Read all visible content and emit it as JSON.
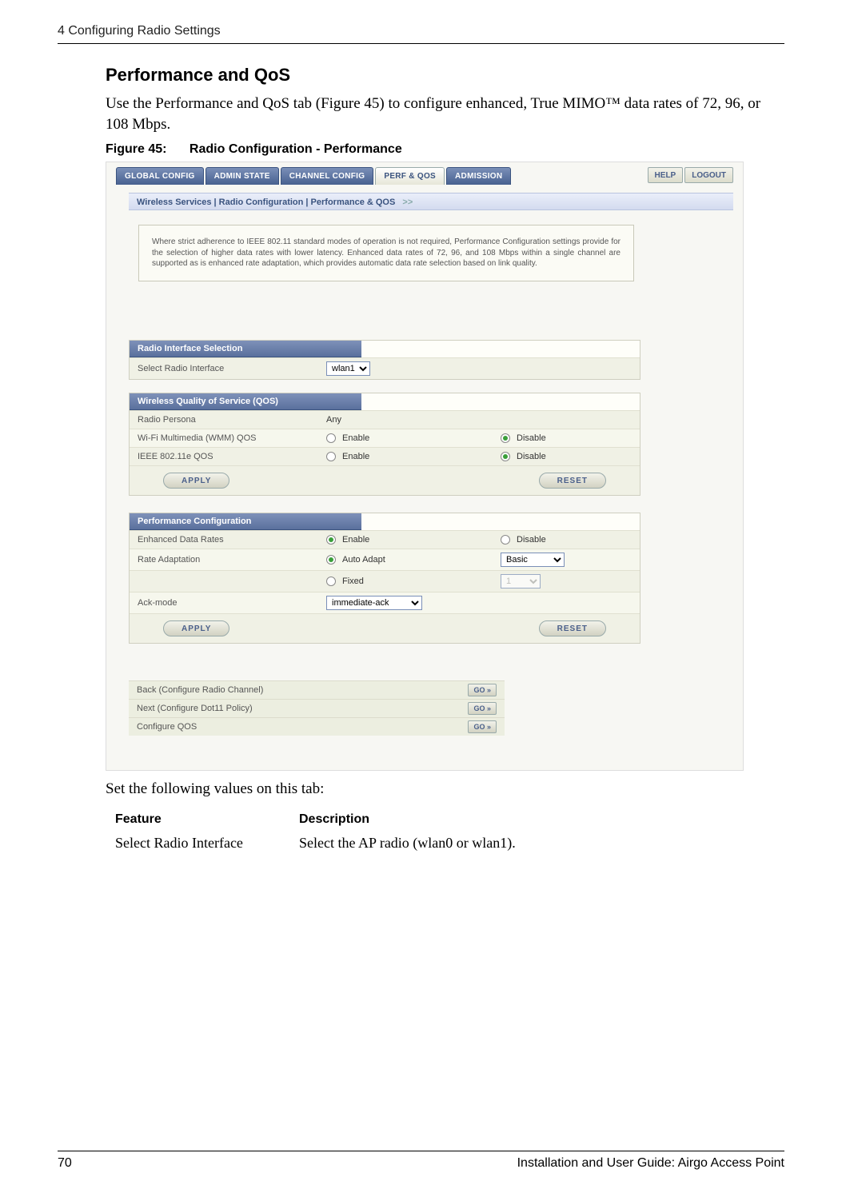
{
  "header": {
    "left": "4  Configuring Radio Settings"
  },
  "section": {
    "title": "Performance and QoS",
    "intro": "Use the Performance and QoS tab (Figure 45) to configure enhanced, True MIMO™ data rates of 72, 96, or 108 Mbps.",
    "figure_label_num": "Figure 45:",
    "figure_label_txt": "Radio Configuration - Performance",
    "after_fig": "Set the following values on this tab:"
  },
  "screenshot": {
    "tabs": [
      "GLOBAL CONFIG",
      "ADMIN STATE",
      "CHANNEL CONFIG",
      "PERF & QOS",
      "ADMISSION"
    ],
    "active_tab_index": 3,
    "help": "HELP",
    "logout": "LOGOUT",
    "breadcrumb": "Wireless Services | Radio Configuration | Performance & QOS",
    "breadcrumb_chev": ">>",
    "desc": "Where strict adherence to IEEE 802.11 standard modes of operation is not required, Performance Configuration settings provide for the selection of higher data rates with lower latency. Enhanced data rates of 72, 96, and 108 Mbps within a single channel are supported as is enhanced rate adaptation, which provides automatic data rate selection based on link quality.",
    "panel_radio": {
      "title": "Radio Interface Selection",
      "row_label": "Select Radio Interface",
      "select_value": "wlan1"
    },
    "panel_qos": {
      "title": "Wireless Quality of Service (QOS)",
      "rows": [
        {
          "label": "Radio Persona",
          "value": "Any"
        },
        {
          "label": "Wi-Fi Multimedia (WMM) QOS",
          "opt1": "Enable",
          "opt2": "Disable",
          "checked": 2
        },
        {
          "label": "IEEE 802.11e QOS",
          "opt1": "Enable",
          "opt2": "Disable",
          "checked": 2
        }
      ],
      "apply": "APPLY",
      "reset": "RESET"
    },
    "panel_perf": {
      "title": "Performance Configuration",
      "rows": [
        {
          "label": "Enhanced Data Rates",
          "opt1": "Enable",
          "opt2": "Disable",
          "checked": 1
        },
        {
          "label": "Rate Adaptation",
          "opt1": "Auto Adapt",
          "sel": "Basic",
          "checked": 1
        },
        {
          "label": "",
          "opt1": "Fixed",
          "sel": "1",
          "checked": 0
        },
        {
          "label": "Ack-mode",
          "sel": "immediate-ack"
        }
      ],
      "apply": "APPLY",
      "reset": "RESET"
    },
    "navlinks": [
      {
        "label": "Back (Configure Radio Channel)",
        "btn": "GO »"
      },
      {
        "label": "Next (Configure Dot11 Policy)",
        "btn": "GO »"
      },
      {
        "label": "Configure QOS",
        "btn": "GO »"
      }
    ]
  },
  "feature_table": {
    "h1": "Feature",
    "h2": "Description",
    "rows": [
      {
        "c1": "Select Radio Interface",
        "c2": "Select the AP radio (wlan0 or wlan1)."
      }
    ]
  },
  "footer": {
    "page": "70",
    "title": "Installation and User Guide: Airgo Access Point"
  }
}
